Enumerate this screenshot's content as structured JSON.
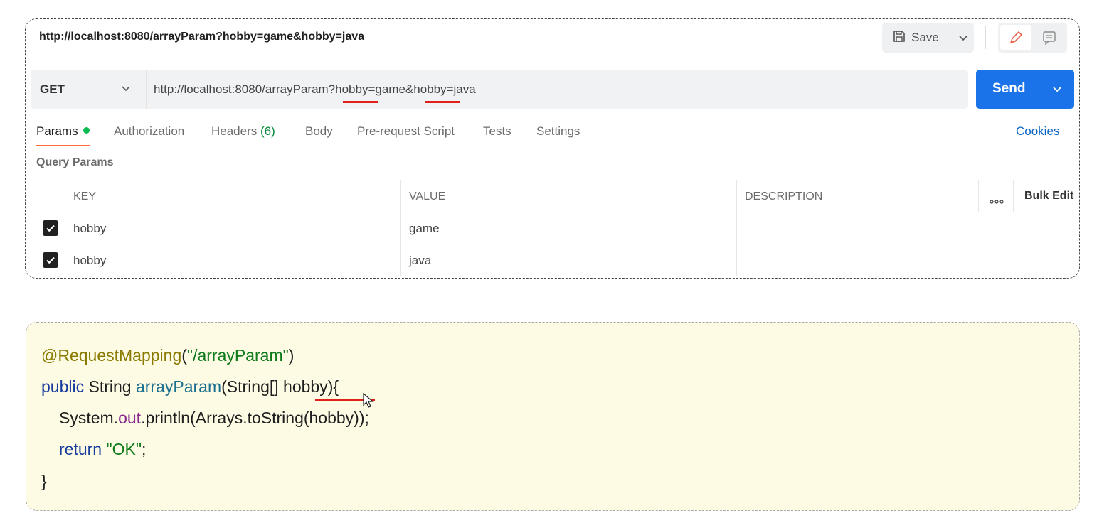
{
  "request": {
    "title_url": "http://localhost:8080/arrayParam?hobby=game&hobby=java",
    "save_label": "Save",
    "method": "GET",
    "url": "http://localhost:8080/arrayParam?hobby=game&hobby=java",
    "send_label": "Send"
  },
  "tabs": {
    "params": "Params",
    "authorization": "Authorization",
    "headers": "Headers",
    "headers_count": "(6)",
    "body": "Body",
    "prerequest": "Pre-request Script",
    "tests": "Tests",
    "settings": "Settings",
    "cookies": "Cookies"
  },
  "params": {
    "section_label": "Query Params",
    "columns": {
      "key": "KEY",
      "value": "VALUE",
      "description": "DESCRIPTION",
      "bulk_edit": "Bulk Edit"
    },
    "rows": [
      {
        "checked": true,
        "key": "hobby",
        "value": "game",
        "description": ""
      },
      {
        "checked": true,
        "key": "hobby",
        "value": "java",
        "description": ""
      }
    ]
  },
  "code": {
    "annotation": "@RequestMapping",
    "paren_open": "(",
    "path_string": "\"/arrayParam\"",
    "paren_close": ")",
    "kw_public": "public",
    "ret_type": " String ",
    "method_name": "arrayParam",
    "signature_rest": "(String[] hobby){",
    "print_prefix": "System.",
    "print_out": "out",
    "print_rest": ".println(Arrays.toString(hobby));",
    "kw_return": "return",
    "return_value": "\"OK\"",
    "semicolon": ";",
    "close_brace": "}"
  },
  "colors": {
    "send_blue": "#1a73e8",
    "tab_accent": "#ff6c37",
    "status_green": "#0cbb52",
    "annotation_red": "#e0201b",
    "code_background": "#fdfbe4"
  }
}
